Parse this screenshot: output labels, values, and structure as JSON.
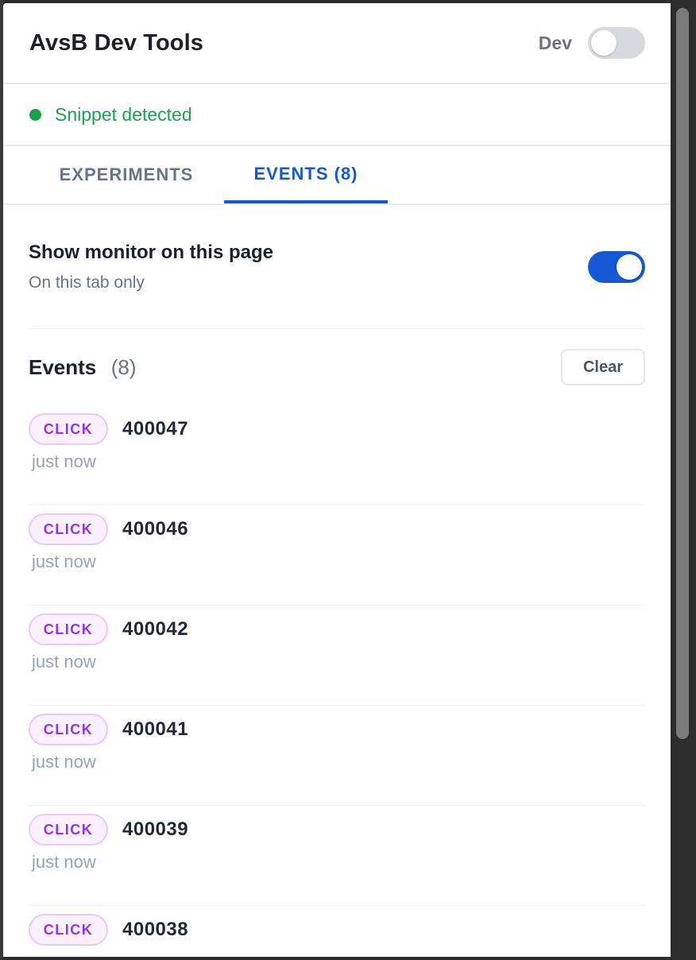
{
  "header": {
    "title": "AvsB Dev Tools",
    "dev_label": "Dev",
    "dev_toggle_on": false
  },
  "status": {
    "text": "Snippet detected",
    "color": "#16a34a"
  },
  "tabs": [
    {
      "label": "EXPERIMENTS",
      "active": false
    },
    {
      "label": "EVENTS (8)",
      "active": true
    }
  ],
  "monitor": {
    "title": "Show monitor on this page",
    "subtitle": "On this tab only",
    "toggle_on": true
  },
  "events": {
    "title": "Events",
    "count": "(8)",
    "clear_label": "Clear",
    "items": [
      {
        "type": "CLICK",
        "id": "400047",
        "time": "just now"
      },
      {
        "type": "CLICK",
        "id": "400046",
        "time": "just now"
      },
      {
        "type": "CLICK",
        "id": "400042",
        "time": "just now"
      },
      {
        "type": "CLICK",
        "id": "400041",
        "time": "just now"
      },
      {
        "type": "CLICK",
        "id": "400039",
        "time": "just now"
      },
      {
        "type": "CLICK",
        "id": "400038",
        "time": ""
      }
    ]
  },
  "colors": {
    "accent": "#1558d6",
    "success": "#16a34a",
    "badge_text": "#9333ea",
    "badge_bg": "#fbf0ff"
  }
}
